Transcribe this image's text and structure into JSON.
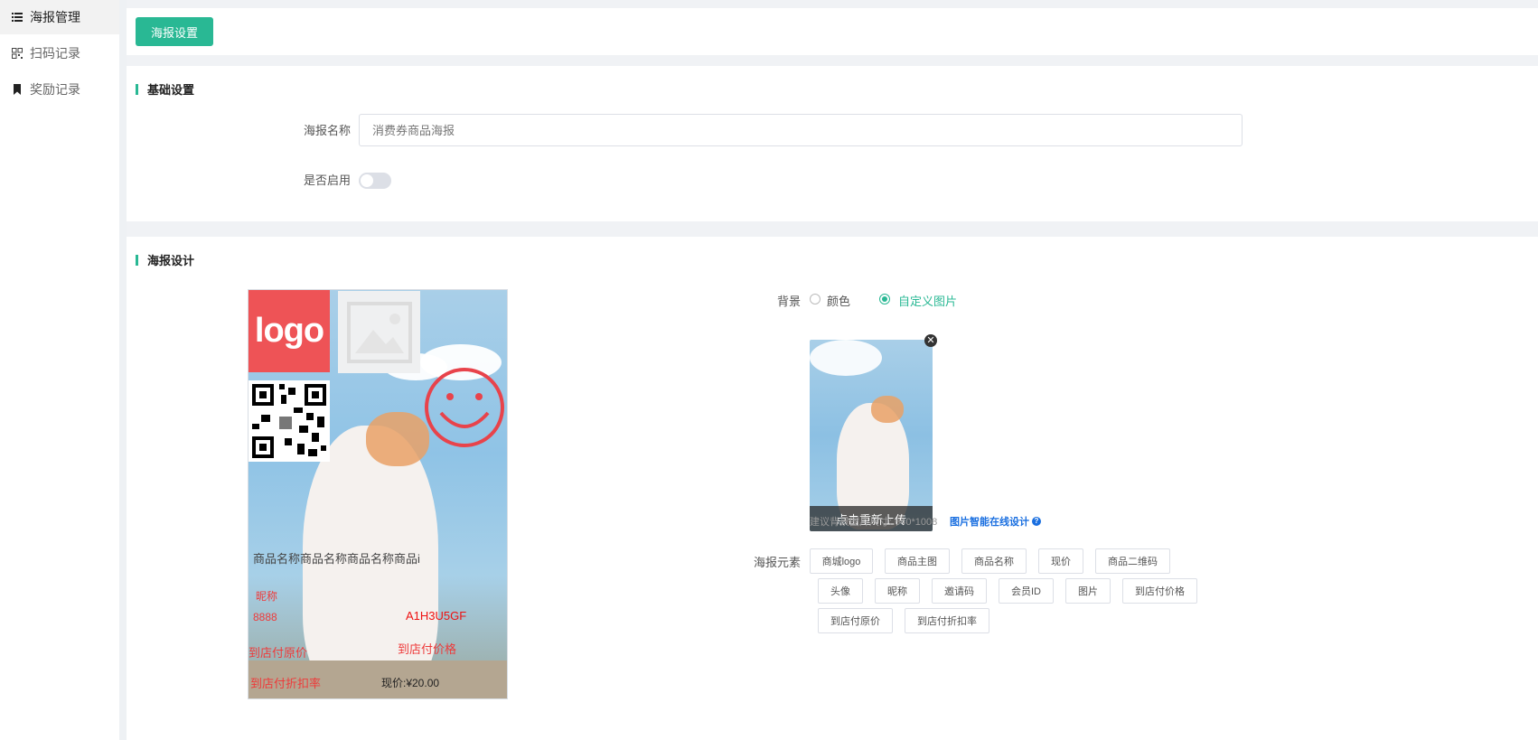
{
  "sidebar": {
    "items": [
      {
        "label": "海报管理",
        "icon": "list-icon"
      },
      {
        "label": "扫码记录",
        "icon": "qrcode-icon"
      },
      {
        "label": "奖励记录",
        "icon": "bookmark-icon"
      }
    ]
  },
  "toolbar": {
    "poster_settings_label": "海报设置"
  },
  "basic": {
    "title": "基础设置",
    "name_label": "海报名称",
    "name_placeholder": "消费券商品海报",
    "enable_label": "是否启用",
    "enabled": false
  },
  "design": {
    "title": "海报设计",
    "poster": {
      "logo_text": "logo",
      "product_name": "商品名称商品名称商品名称商品i",
      "nickname": "昵称",
      "number": "8888",
      "invite_code": "A1H3U5GF",
      "store_original_price": "到店付原价",
      "store_price": "到店付价格",
      "store_discount": "到店付折扣率",
      "current_price": "现价:¥20.00"
    },
    "background": {
      "label": "背景",
      "options": [
        "颜色",
        "自定义图片"
      ],
      "selected": "自定义图片",
      "reupload_label": "点击重新上传",
      "size_hint": "建议背景图片尺寸: 640*1008",
      "online_design_link": "图片智能在线设计"
    },
    "elements": {
      "label": "海报元素",
      "tags": [
        "商城logo",
        "商品主图",
        "商品名称",
        "现价",
        "商品二维码",
        "头像",
        "昵称",
        "邀请码",
        "会员ID",
        "图片",
        "到店付价格",
        "到店付原价",
        "到店付折扣率"
      ]
    }
  },
  "colors": {
    "accent": "#29b894",
    "poster_red": "#ee5356",
    "link_blue": "#1a6fe0"
  }
}
